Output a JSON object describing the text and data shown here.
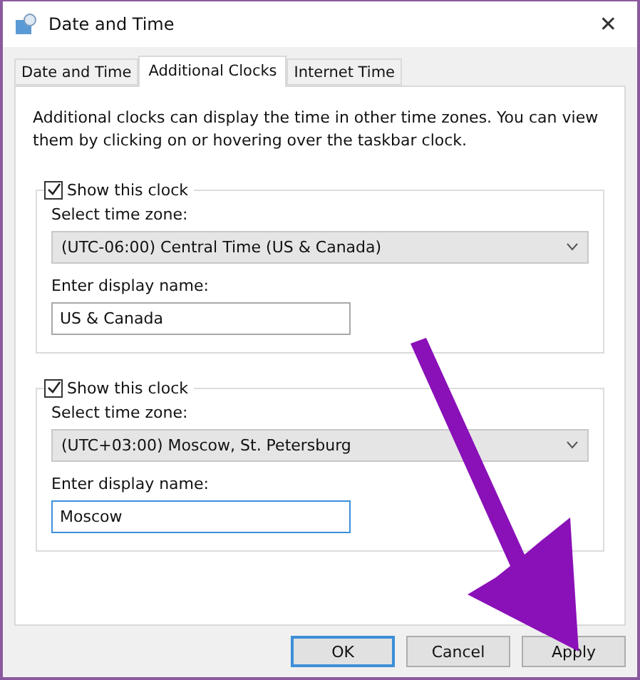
{
  "window": {
    "title": "Date and Time",
    "close": "✕"
  },
  "tabs": [
    {
      "label": "Date and Time",
      "selected": false
    },
    {
      "label": "Additional Clocks",
      "selected": true
    },
    {
      "label": "Internet Time",
      "selected": false
    }
  ],
  "intro": "Additional clocks can display the time in other time zones. You can view them by clicking on or hovering over the taskbar clock.",
  "clocks": [
    {
      "show_label": "Show this clock",
      "checked": true,
      "zone_label": "Select time zone:",
      "zone": "(UTC-06:00) Central Time (US & Canada)",
      "name_label": "Enter display name:",
      "name": "US & Canada",
      "focused": false
    },
    {
      "show_label": "Show this clock",
      "checked": true,
      "zone_label": "Select time zone:",
      "zone": "(UTC+03:00) Moscow, St. Petersburg",
      "name_label": "Enter display name:",
      "name": "Moscow",
      "focused": true
    }
  ],
  "buttons": [
    {
      "label": "OK",
      "default": true
    },
    {
      "label": "Cancel",
      "default": false
    },
    {
      "label": "Apply",
      "default": false
    }
  ]
}
